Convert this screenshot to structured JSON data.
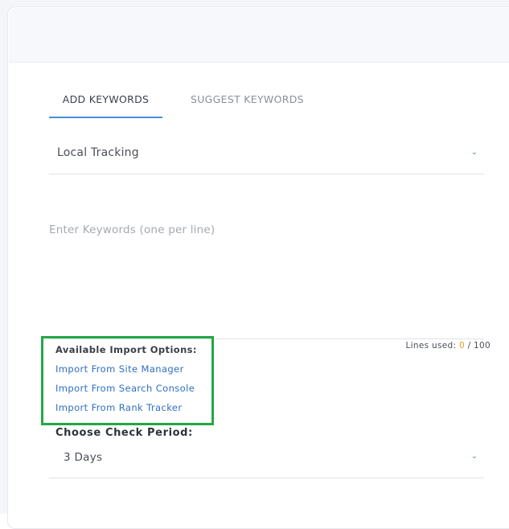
{
  "tabs": [
    {
      "label": "ADD KEYWORDS",
      "active": true
    },
    {
      "label": "SUGGEST KEYWORDS",
      "active": false
    }
  ],
  "tracking_select": {
    "value": "Local Tracking",
    "icon": "chevron-down-icon"
  },
  "keywords": {
    "placeholder": "Enter Keywords (one per line)",
    "lines_used_label": "Lines used:",
    "lines_used": "0",
    "lines_max": "/ 100"
  },
  "import_options": {
    "title": "Available Import Options:",
    "links": [
      "Import From Site Manager",
      "Import From Search Console",
      "Import From Rank Tracker"
    ],
    "highlight_color": "#22a846"
  },
  "check_period": {
    "label": "Choose Check Period:",
    "value": "3 Days",
    "icon": "chevron-down-icon"
  },
  "colors": {
    "accent": "#4b8fd3",
    "link": "#2f6fc4",
    "count": "#e6a020"
  }
}
